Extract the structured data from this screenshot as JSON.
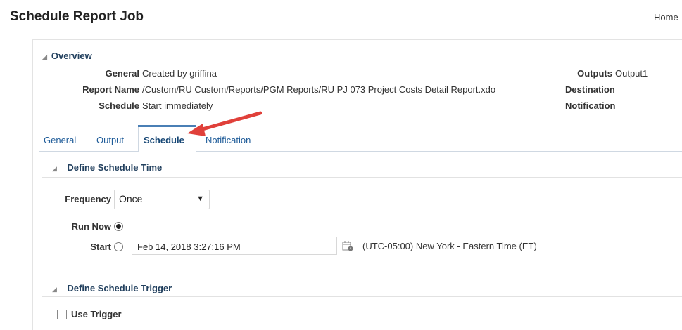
{
  "header": {
    "title": "Schedule Report Job",
    "home_link": "Home"
  },
  "overview": {
    "heading": "Overview",
    "fields": [
      {
        "label": "General",
        "value": "Created by griffina"
      },
      {
        "label": "Report Name",
        "value": "/Custom/RU Custom/Reports/PGM Reports/RU PJ 073 Project Costs Detail Report.xdo"
      },
      {
        "label": "Schedule",
        "value": "Start immediately"
      }
    ],
    "right_fields": [
      {
        "label": "Outputs",
        "value": "Output1"
      },
      {
        "label": "Destination",
        "value": ""
      },
      {
        "label": "Notification",
        "value": ""
      }
    ]
  },
  "tabs": [
    {
      "label": "General"
    },
    {
      "label": "Output"
    },
    {
      "label": "Schedule",
      "selected": true
    },
    {
      "label": "Notification"
    }
  ],
  "schedule_time": {
    "heading": "Define Schedule Time",
    "frequency_label": "Frequency",
    "frequency_value": "Once",
    "run_now_label": "Run Now",
    "run_now_selected": true,
    "start_label": "Start",
    "start_value": "Feb 14, 2018 3:27:16 PM",
    "timezone": "(UTC-05:00) New York - Eastern Time (ET)"
  },
  "schedule_trigger": {
    "heading": "Define Schedule Trigger",
    "use_trigger_label": "Use Trigger",
    "use_trigger_checked": false
  },
  "colors": {
    "accent": "#4a7fb5",
    "link": "#1f5c99",
    "annotation_arrow": "#e0403a"
  }
}
